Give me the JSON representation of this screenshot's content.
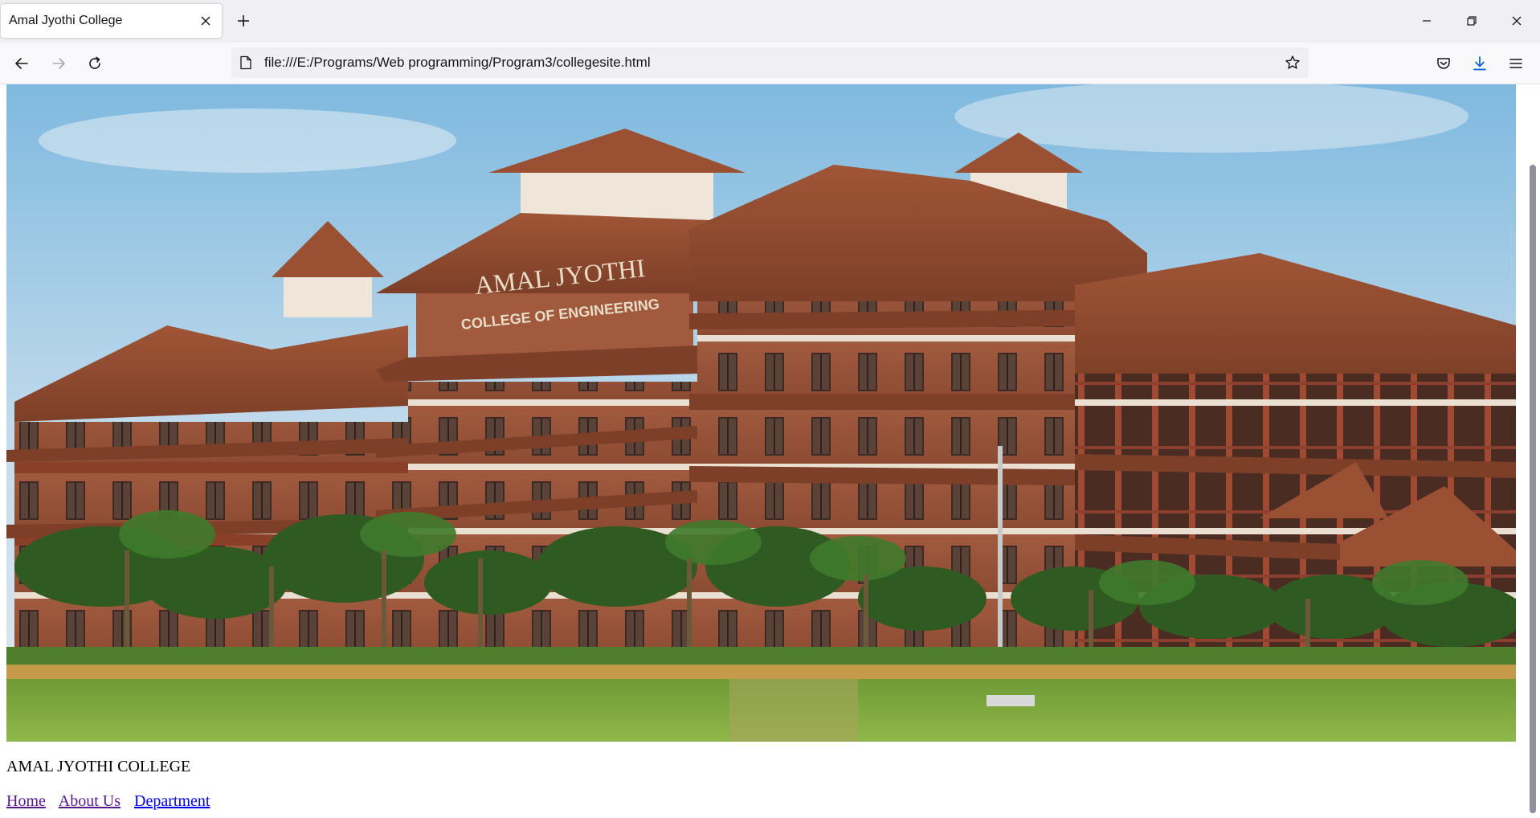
{
  "browser": {
    "tab": {
      "title": "Amal Jyothi College",
      "close_icon": "close-icon"
    },
    "new_tab_icon": "plus-icon",
    "window_controls": [
      "minimize-icon",
      "restore-icon",
      "close-icon"
    ],
    "navigation": {
      "back_icon": "arrow-left-icon",
      "forward_icon": "arrow-right-icon",
      "forward_enabled": false,
      "reload_icon": "reload-icon"
    },
    "address_bar": {
      "url": "file:///E:/Programs/Web programming/Program3/collegesite.html",
      "page_icon": "page-icon",
      "bookmark_icon": "star-icon"
    },
    "toolbar_icons": [
      "pocket-icon",
      "download-icon",
      "menu-icon"
    ],
    "accent_color": "#0060df"
  },
  "page": {
    "image": {
      "subject": "campus-photo",
      "sign_text": [
        "AMAL JYOTHI",
        "COLLEGE OF ENGINEERING"
      ]
    },
    "heading": "AMAL JYOTHI COLLEGE",
    "nav_links": [
      {
        "label": "Home",
        "state": "visited",
        "color": "#551a8b"
      },
      {
        "label": "About Us",
        "state": "visited",
        "color": "#551a8b"
      },
      {
        "label": "Department",
        "state": "unvisited",
        "color": "#0000ee"
      }
    ]
  }
}
